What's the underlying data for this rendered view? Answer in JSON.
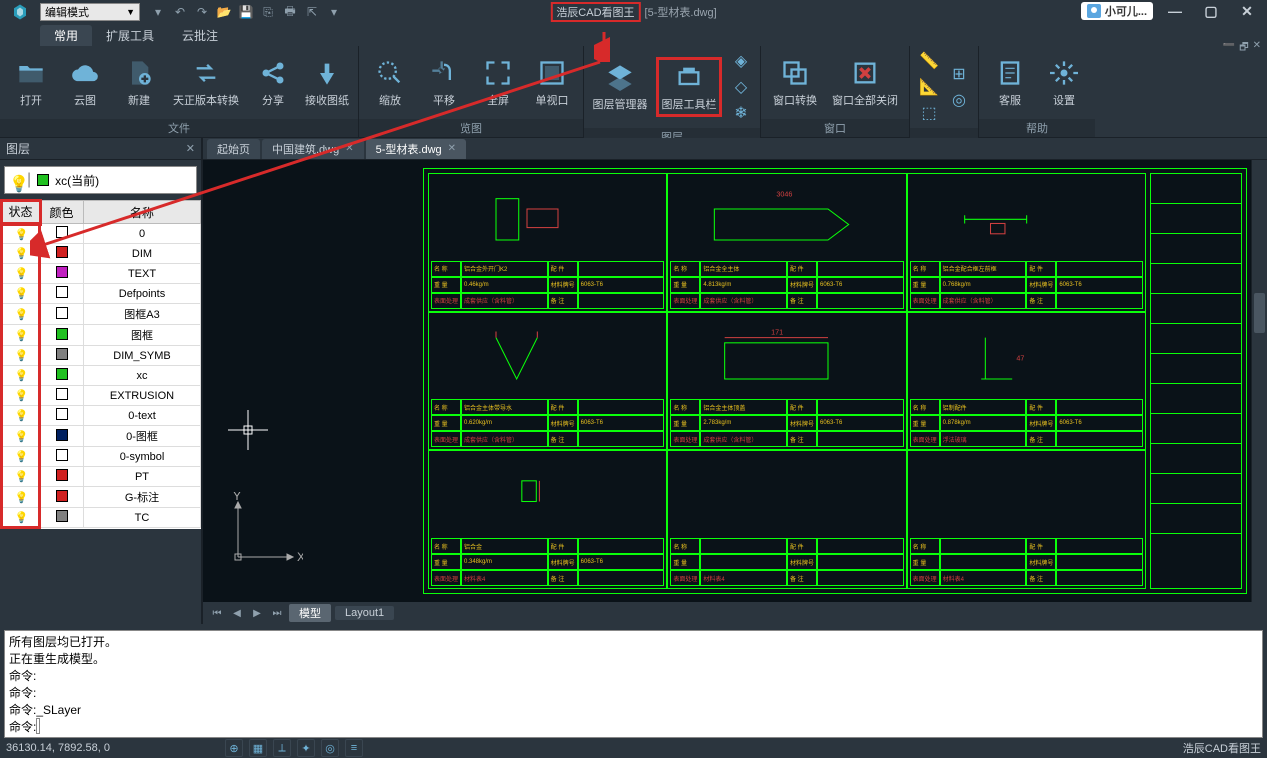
{
  "title": {
    "app_name": "浩辰CAD看图王",
    "doc_name": "[5-型材表.dwg]",
    "mode_combo": "编辑模式",
    "user_name": "小可儿..."
  },
  "ribbon": {
    "tabs": [
      "常用",
      "扩展工具",
      "云批注"
    ],
    "groups": {
      "file": {
        "label": "文件",
        "buttons": [
          "打开",
          "云图",
          "新建",
          "天正版本转换",
          "分享",
          "接收图纸"
        ]
      },
      "view": {
        "label": "览图",
        "buttons": [
          "缩放",
          "平移",
          "全屏",
          "单视口"
        ]
      },
      "layer": {
        "label": "图层",
        "buttons": [
          "图层管理器",
          "图层工具栏"
        ]
      },
      "window": {
        "label": "窗口",
        "buttons": [
          "窗口转换",
          "窗口全部关闭"
        ]
      },
      "help": {
        "label": "帮助",
        "buttons": [
          "客服",
          "设置"
        ]
      }
    }
  },
  "layer_panel": {
    "title": "图层",
    "current": "xc(当前)",
    "headers": [
      "状态",
      "颜色",
      "名称"
    ],
    "rows": [
      {
        "color": "#ffffff",
        "name": "0"
      },
      {
        "color": "#d02020",
        "name": "DIM"
      },
      {
        "color": "#c020c0",
        "name": "TEXT"
      },
      {
        "color": "#ffffff",
        "name": "Defpoints"
      },
      {
        "color": "#ffffff",
        "name": "图框A3"
      },
      {
        "color": "#20c020",
        "name": "图框"
      },
      {
        "color": "#808080",
        "name": "DIM_SYMB"
      },
      {
        "color": "#20c020",
        "name": "xc"
      },
      {
        "color": "#ffffff",
        "name": "EXTRUSION"
      },
      {
        "color": "#ffffff",
        "name": "0-text"
      },
      {
        "color": "#002060",
        "name": "0-图框"
      },
      {
        "color": "#ffffff",
        "name": "0-symbol"
      },
      {
        "color": "#d02020",
        "name": "PT"
      },
      {
        "color": "#d02020",
        "name": "G-标注"
      },
      {
        "color": "#808080",
        "name": "TC"
      }
    ]
  },
  "doc_tabs": [
    "起始页",
    "中国建筑.dwg",
    "5-型材表.dwg"
  ],
  "model_tabs": [
    "模型",
    "Layout1"
  ],
  "ucs": {
    "x": "X",
    "y": "Y"
  },
  "command": {
    "lines": [
      "所有图层均已打开。",
      "正在重生成模型。",
      "命令:",
      "命令:",
      "命令:_SLayer"
    ],
    "prompt": "命令:"
  },
  "drawing_cells": {
    "r1c1": {
      "label1": "铝合金外开门K2",
      "label2": "0.46kg/m",
      "label3": "6063-T6",
      "label4": "成套供应（含料管）"
    },
    "r1c2": {
      "label1": "铝合金全主体",
      "label2": "4.813kg/m",
      "label3": "6063-T6",
      "label4": "成套供应（含料管）"
    },
    "r1c3": {
      "label1": "铝合金配合框左前框",
      "label2": "0.768kg/m",
      "label3": "6063-T6",
      "label4": "成套供应（含料管）"
    },
    "r2c1": {
      "label1": "铝合金主体带导水",
      "label2": "0.620kg/m",
      "label3": "6063-T6",
      "label4": "成套供应（含料管）"
    },
    "r2c2": {
      "label1": "铝合金主体顶盖",
      "label2": "2.783kg/m",
      "label3": "6063-T6",
      "label4": "成套供应（含料管）"
    },
    "r2c3": {
      "label1": "铝制配件",
      "label2": "0.878kg/m",
      "label3": "6063-T6",
      "label4": "浮法玻璃"
    },
    "r3c1": {
      "label1": "铝合金",
      "label2": "0.348kg/m",
      "label3": "6063-T6",
      "label4": "材料表4"
    },
    "r3c2": {
      "label1": "",
      "label2": "",
      "label3": "",
      "label4": "材料表4"
    },
    "r3c3": {
      "label1": "",
      "label2": "",
      "label3": "",
      "label4": "材料表4"
    }
  },
  "status": {
    "coords": "36130.14, 7892.58, 0",
    "brand": "浩辰CAD看图王"
  }
}
